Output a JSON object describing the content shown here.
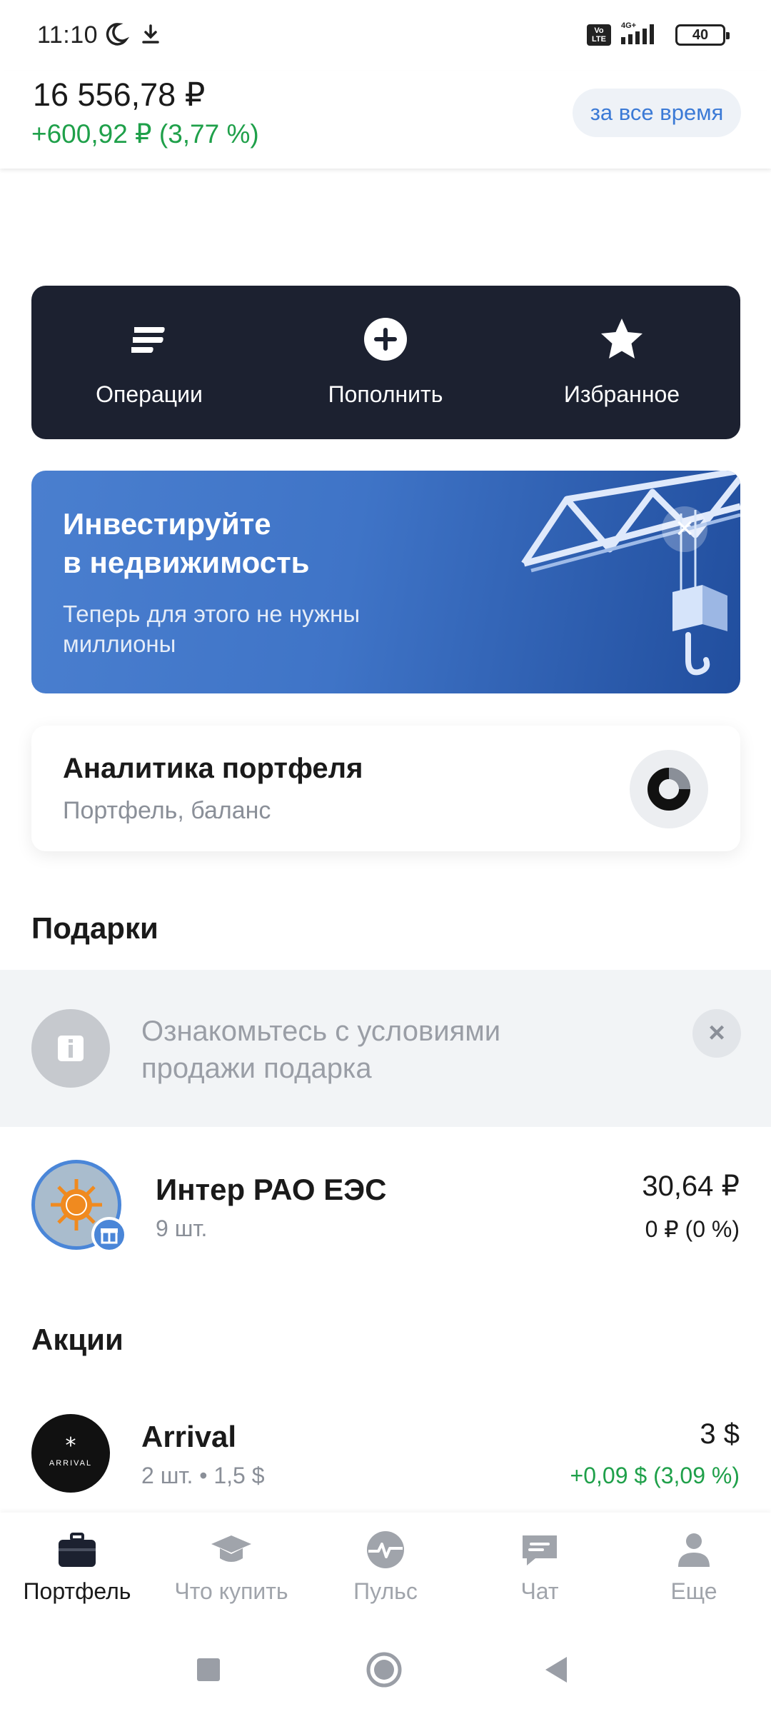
{
  "status_bar": {
    "time": "11:10",
    "battery": "40",
    "volte": "Vo LTE",
    "network": "4G+"
  },
  "header": {
    "balance": "16 556,78 ₽",
    "change": "+600,92 ₽ (3,77 %)",
    "period": "за все время"
  },
  "actions": [
    {
      "label": "Операции",
      "icon": "operations-icon"
    },
    {
      "label": "Пополнить",
      "icon": "plus-circle-icon"
    },
    {
      "label": "Избранное",
      "icon": "star-icon"
    }
  ],
  "promo": {
    "title_line1": "Инвестируйте",
    "title_line2": "в недвижимость",
    "subtitle_line1": "Теперь для этого не нужны",
    "subtitle_line2": "миллионы"
  },
  "analytics": {
    "title": "Аналитика портфеля",
    "subtitle": "Портфель, баланс"
  },
  "gifts": {
    "section_title": "Подарки",
    "notice_line1": "Ознакомьтесь с условиями",
    "notice_line2": "продажи подарка",
    "items": [
      {
        "name": "Интер РАО ЕЭС",
        "qty": "9 шт.",
        "price": "30,64 ₽",
        "change": "0 ₽ (0 %)"
      }
    ]
  },
  "stocks": {
    "section_title": "Акции",
    "items": [
      {
        "name": "Arrival",
        "qty": "2 шт. • 1,5 $",
        "price": "3 $",
        "change": "+0,09 $ (3,09 %)",
        "logo_text": "ARRIVAL"
      }
    ]
  },
  "bottom_nav": [
    {
      "label": "Портфель",
      "icon": "briefcase-icon",
      "active": true
    },
    {
      "label": "Что купить",
      "icon": "graduation-cap-icon",
      "active": false
    },
    {
      "label": "Пульс",
      "icon": "pulse-icon",
      "active": false
    },
    {
      "label": "Чат",
      "icon": "chat-icon",
      "active": false
    },
    {
      "label": "Еще",
      "icon": "profile-icon",
      "active": false
    }
  ],
  "colors": {
    "positive": "#1fa04a",
    "accent": "#3b7ad6",
    "dark_card": "#1c2130"
  }
}
